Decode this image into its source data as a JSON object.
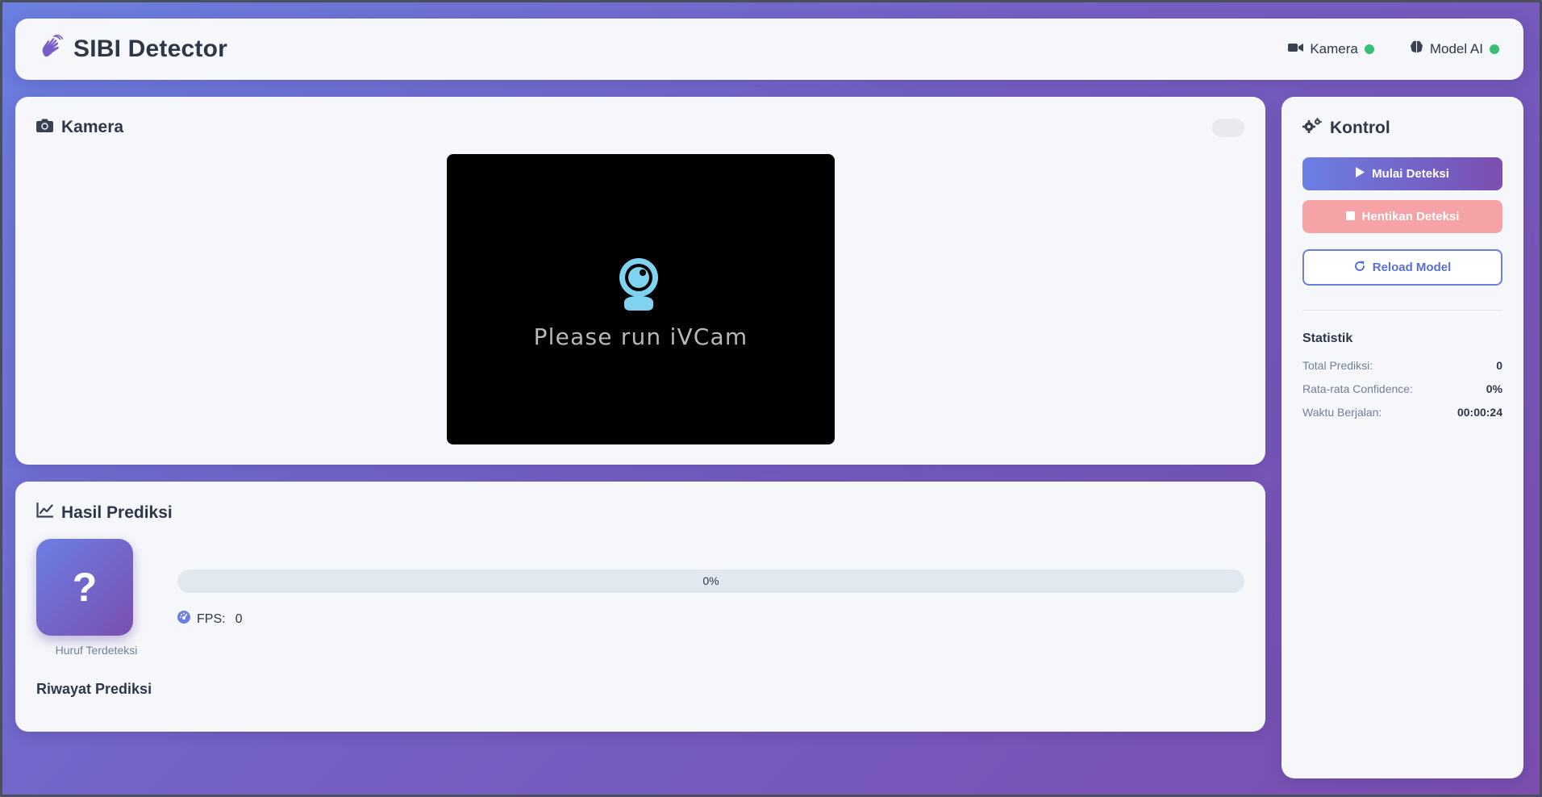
{
  "header": {
    "title": "SIBI Detector",
    "status": {
      "camera_label": "Kamera",
      "model_label": "Model AI",
      "ok_color": "#38c172"
    }
  },
  "camera": {
    "title": "Kamera",
    "video_message": "Please run iVCam"
  },
  "prediction": {
    "title": "Hasil Prediksi",
    "letter": "?",
    "letter_caption": "Huruf Terdeteksi",
    "confidence_text": "0%",
    "confidence_value": 0,
    "fps_label": "FPS:",
    "fps_value": "0",
    "history_title": "Riwayat Prediksi"
  },
  "control": {
    "title": "Kontrol",
    "start_label": "Mulai Deteksi",
    "stop_label": "Hentikan Deteksi",
    "reload_label": "Reload Model",
    "stats_title": "Statistik",
    "stats": [
      {
        "label": "Total Prediksi:",
        "value": "0"
      },
      {
        "label": "Rata-rata Confidence:",
        "value": "0%"
      },
      {
        "label": "Waktu Berjalan:",
        "value": "00:00:24"
      }
    ]
  },
  "colors": {
    "accent_start": "#6c7fe4",
    "accent_end": "#7a4fb0",
    "danger_soft": "#f5a3a6",
    "webcam_icon": "#7fd3f0"
  }
}
